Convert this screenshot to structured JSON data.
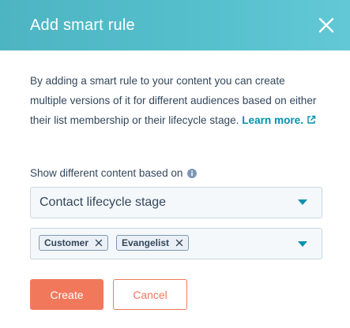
{
  "dialog": {
    "title": "Add smart rule",
    "description": "By adding a smart rule to your content you can create multiple versions of it for different audiences based on either their list membership or their lifecycle stage. ",
    "learn_more_label": "Learn more.",
    "close_icon": "close-icon"
  },
  "form": {
    "label": "Show different content based on",
    "info_icon": "info-icon",
    "rule_type": {
      "selected": "Contact lifecycle stage"
    },
    "stages": {
      "selected_tags": [
        "Customer",
        "Evangelist"
      ]
    }
  },
  "actions": {
    "create_label": "Create",
    "cancel_label": "Cancel"
  },
  "colors": {
    "header": "#55bfcc",
    "text": "#33475b",
    "link": "#0091ae",
    "primary": "#f2785c",
    "input_bg": "#f5f8fa",
    "input_border": "#cbd6e2",
    "tag_bg": "#eaf0f6",
    "tag_border": "#7c98b6"
  }
}
